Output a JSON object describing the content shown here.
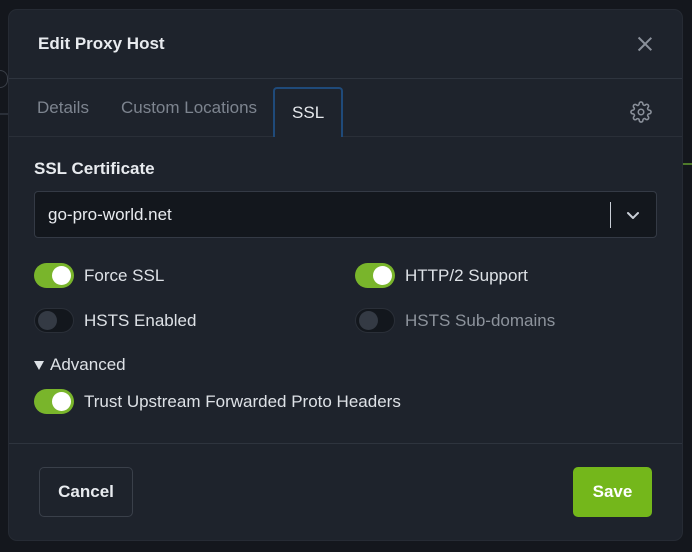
{
  "modal": {
    "title": "Edit Proxy Host",
    "close_icon": "close-icon"
  },
  "tabs": [
    {
      "label": "Details",
      "active": false
    },
    {
      "label": "Custom Locations",
      "active": false
    },
    {
      "label": "SSL",
      "active": true
    }
  ],
  "settings_icon": "gear-icon",
  "ssl": {
    "certificate_label": "SSL Certificate",
    "certificate_value": "go-pro-world.net",
    "toggles": [
      {
        "label": "Force SSL",
        "on": true
      },
      {
        "label": "HTTP/2 Support",
        "on": true
      },
      {
        "label": "HSTS Enabled",
        "on": false
      },
      {
        "label": "HSTS Sub-domains",
        "on": false
      }
    ],
    "advanced_label": "Advanced",
    "advanced_toggle": {
      "label": "Trust Upstream Forwarded Proto Headers",
      "on": true
    }
  },
  "footer": {
    "cancel_label": "Cancel",
    "save_label": "Save"
  },
  "colors": {
    "accent_green": "#74b71b",
    "toggle_on": "#79b52b",
    "active_tab_border": "#1f4a7a",
    "modal_bg": "#1e232c"
  }
}
